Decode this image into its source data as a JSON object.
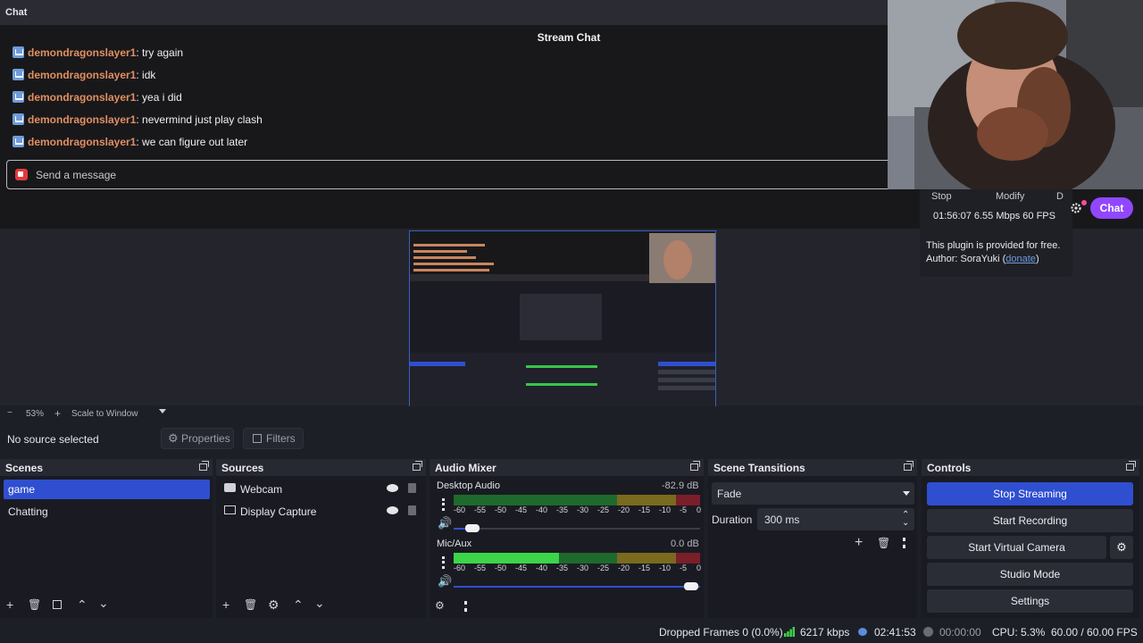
{
  "chat": {
    "dock_title": "Chat",
    "title": "Stream Chat",
    "messages": [
      {
        "user": "demondragonslayer1",
        "text": ": try again"
      },
      {
        "user": "demondragonslayer1",
        "text": ": idk"
      },
      {
        "user": "demondragonslayer1",
        "text": ": yea i did"
      },
      {
        "user": "demondragonslayer1",
        "text": ": nevermind just play clash"
      },
      {
        "user": "demondragonslayer1",
        "text": ": we can figure out later"
      }
    ],
    "input_placeholder": "Send a message",
    "chat_button": "Chat"
  },
  "plugin": {
    "stop": "Stop",
    "modify": "Modify",
    "extra": "D",
    "stats": "01:56:07  6.55 Mbps  60 FPS",
    "free_text": "This plugin is provided for free.",
    "author_prefix": "Author: SoraYuki (",
    "donate": "donate",
    "author_suffix": ")"
  },
  "zoom": {
    "minus": "−",
    "value": "53%",
    "plus": "+",
    "mode": "Scale to Window"
  },
  "source_bar": {
    "status": "No source selected",
    "properties": "Properties",
    "filters": "Filters"
  },
  "scenes": {
    "title": "Scenes",
    "items": [
      "game",
      "Chatting"
    ],
    "selected": "game"
  },
  "sources": {
    "title": "Sources",
    "items": [
      "Webcam",
      "Display Capture"
    ]
  },
  "mixer": {
    "title": "Audio Mixer",
    "channels": [
      {
        "name": "Desktop Audio",
        "level": "-82.9 dB",
        "volume": 0.07
      },
      {
        "name": "Mic/Aux",
        "level": "0.0 dB",
        "volume": 1.0
      }
    ],
    "scale": [
      "-60",
      "-55",
      "-50",
      "-45",
      "-40",
      "-35",
      "-30",
      "-25",
      "-20",
      "-15",
      "-10",
      "-5",
      "0"
    ]
  },
  "transitions": {
    "title": "Scene Transitions",
    "type": "Fade",
    "duration_label": "Duration",
    "duration_value": "300 ms"
  },
  "controls": {
    "title": "Controls",
    "buttons": [
      "Stop Streaming",
      "Start Recording",
      "Start Virtual Camera",
      "Studio Mode",
      "Settings"
    ],
    "accent": "#2f4fd0"
  },
  "status": {
    "dropped": "Dropped Frames 0 (0.0%)",
    "bitrate": "6217 kbps",
    "stream_time": "02:41:53",
    "record_time": "00:00:00",
    "cpu": "CPU: 5.3%",
    "fps": "60.00 / 60.00 FPS"
  }
}
